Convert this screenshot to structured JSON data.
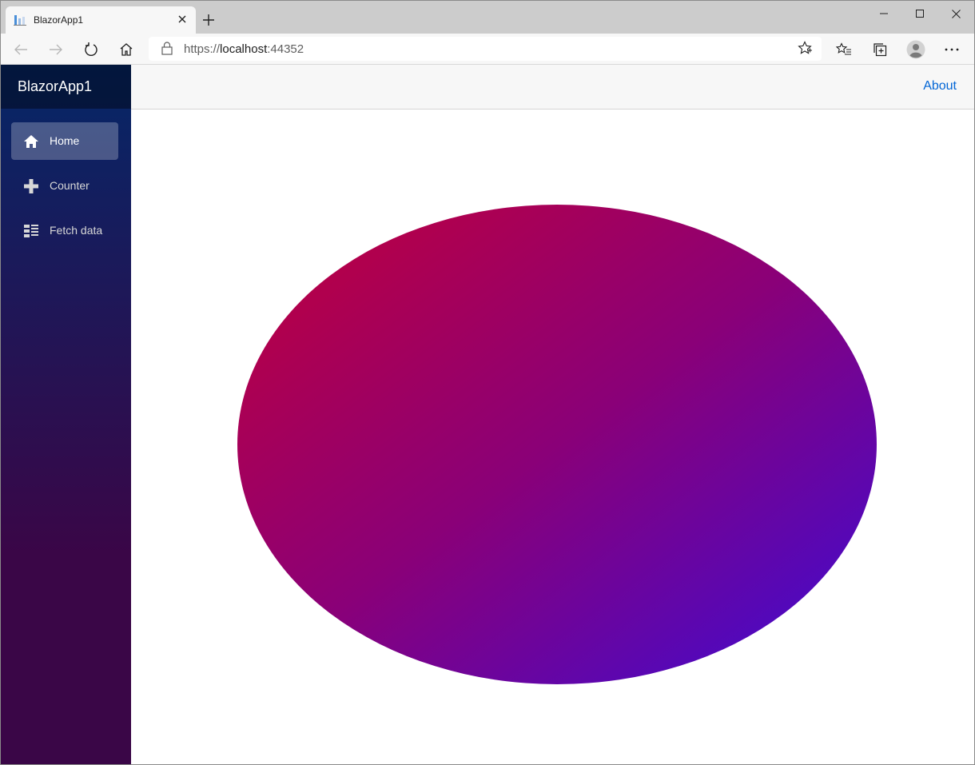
{
  "browser": {
    "tab_title": "BlazorApp1",
    "url_protocol": "https://",
    "url_host": "localhost",
    "url_port": ":44352",
    "icons": {
      "back": "back-arrow-icon",
      "forward": "forward-arrow-icon",
      "refresh": "refresh-icon",
      "home": "home-icon",
      "lock": "lock-icon",
      "favorite": "star-icon",
      "favorites": "favorites-list-icon",
      "collections": "collections-icon",
      "profile": "profile-icon",
      "more": "more-icon"
    }
  },
  "app": {
    "brand": "BlazorApp1",
    "nav": [
      {
        "label": "Home",
        "icon": "home-icon",
        "active": true
      },
      {
        "label": "Counter",
        "icon": "plus-icon",
        "active": false
      },
      {
        "label": "Fetch data",
        "icon": "list-icon",
        "active": false
      }
    ],
    "about_link": "About"
  },
  "ellipse": {
    "gradient_start": "#c2003a",
    "gradient_mid": "#8a0078",
    "gradient_end": "#3c0bd6"
  },
  "colors": {
    "sidebar_top": "#052767",
    "sidebar_bottom": "#3a0647",
    "link": "#0366d6"
  }
}
